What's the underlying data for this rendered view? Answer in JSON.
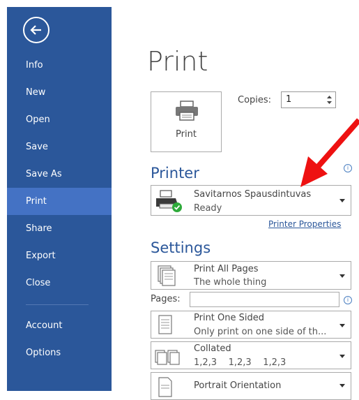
{
  "sidebar": {
    "items": [
      {
        "label": "Info"
      },
      {
        "label": "New"
      },
      {
        "label": "Open"
      },
      {
        "label": "Save"
      },
      {
        "label": "Save As"
      },
      {
        "label": "Print"
      },
      {
        "label": "Share"
      },
      {
        "label": "Export"
      },
      {
        "label": "Close"
      },
      {
        "label": "Account"
      },
      {
        "label": "Options"
      }
    ],
    "active": "Print"
  },
  "main": {
    "title": "Print",
    "print_button": "Print",
    "copies_label": "Copies:",
    "copies_value": "1",
    "printer_section": "Printer",
    "printer_name": "Savitarnos Spausdintuvas",
    "printer_status": "Ready",
    "printer_properties": "Printer Properties",
    "settings_section": "Settings",
    "settings": [
      {
        "line1": "Print All Pages",
        "line2": "The whole thing"
      },
      {
        "line1": "Print One Sided",
        "line2": "Only print on one side of th..."
      },
      {
        "line1": "Collated",
        "line2": "1,2,3    1,2,3    1,2,3"
      },
      {
        "line1": "Portrait Orientation",
        "line2": ""
      }
    ],
    "pages_label": "Pages:",
    "pages_value": ""
  },
  "colors": {
    "sidebar": "#2b579a",
    "active": "#4472c4",
    "accent": "#2b579a",
    "arrow": "#ee1111"
  }
}
